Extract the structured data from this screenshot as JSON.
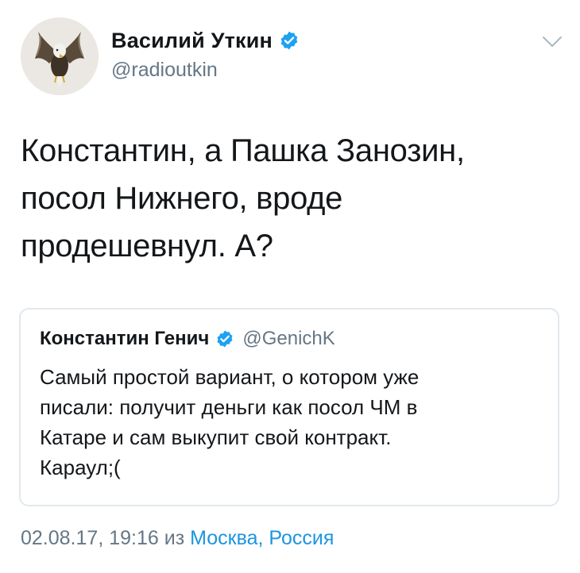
{
  "tweet": {
    "author": {
      "display_name": "Василий Уткин",
      "handle": "@radioutkin",
      "verified": true,
      "avatar_icon": "eagle-avatar"
    },
    "menu_icon": "chevron-down-icon",
    "text": "Константин, а Пашка Занозин,\nпосол Нижнего, вроде\nпродешевнул. А?",
    "quoted_tweet": {
      "display_name": "Константин Генич",
      "handle": "@GenichK",
      "verified": true,
      "text": "Самый простой вариант, о котором уже\nписали: получит деньги как посол ЧМ в\nКатаре и сам выкупит свой контракт.\nКараул;("
    },
    "timestamp": "02.08.17, 19:16",
    "from_word": "из",
    "location": "Москва, Россия"
  },
  "colors": {
    "text_primary": "#14171a",
    "text_secondary": "#657786",
    "link": "#1b95e0",
    "verified_badge": "#1da1f2",
    "quote_border": "#e1e8ed"
  }
}
